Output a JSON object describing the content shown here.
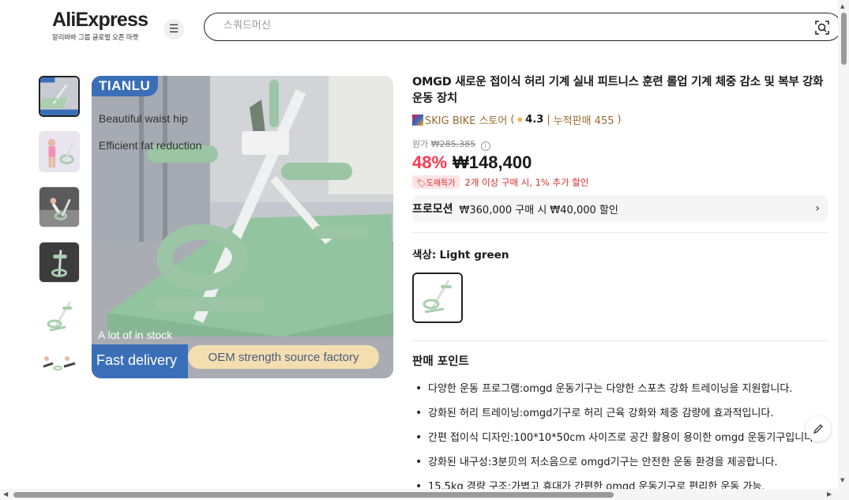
{
  "header": {
    "logo_text": "AliExpress",
    "logo_subtitle": "알리바바 그룹 글로벌 오픈 마켓",
    "menu_icon": "hamburger-icon",
    "search_placeholder": "스쿼드머신",
    "search_icon": "image-search-icon"
  },
  "gallery": {
    "brand": "TIANLU",
    "lines": [
      "Beautiful waist hip",
      "Efficient fat reduction"
    ],
    "stock_text": "A lot of in stock",
    "fast_delivery": "Fast delivery",
    "oem_text": "OEM strength source factory"
  },
  "product": {
    "title": "OMGD 새로운 접이식 허리 기계 실내 피트니스 훈련 롤업 기계 체중 감소 및 복부 강화 운동 장치",
    "store": {
      "name": "SKIG BIKE 스토어",
      "open_paren": "(",
      "rating": "4.3",
      "separator": "|",
      "sold": "누적판매 455",
      "close_paren": ")"
    },
    "original_label": "원가",
    "original_price": "₩285,385",
    "discount": "48%",
    "price": "₩148,400",
    "wholesale_badge": "도매특가",
    "wholesale_text": "2개 이상 구매 시, 1% 추가 할인",
    "promotion_label": "프로모션",
    "promotion_text": "₩360,000 구매 시 ₩40,000 할인",
    "color_label": "색상:",
    "color_value": "Light green",
    "selling_points_title": "판매 포인트",
    "selling_points": [
      "다양한 운동 프로그램:omgd 운동기구는 다양한 스포츠 강화 트레이닝을 지원합니다.",
      "강화된 허리 트레이닝:omgd기구로 허리 근육 강화와 체중 감량에 효과적입니다.",
      "간편 접이식 디자인:100*10*50cm 사이즈로 공간 활용이 용이한 omgd 운동기구입니다.",
      "강화된 내구성:3분贝의 저소음으로 omgd기구는 안전한 운동 환경을 제공합니다.",
      "15.5kg 경량 구조:가볍고 휴대가 간편한 omgd 운동기구로 편리한 운동 가능."
    ]
  },
  "colors": {
    "discount_red": "#fd384f",
    "brand_blue": "#3a6fb8",
    "store_brown": "#9a6a32",
    "mint": "#a9cfae"
  }
}
